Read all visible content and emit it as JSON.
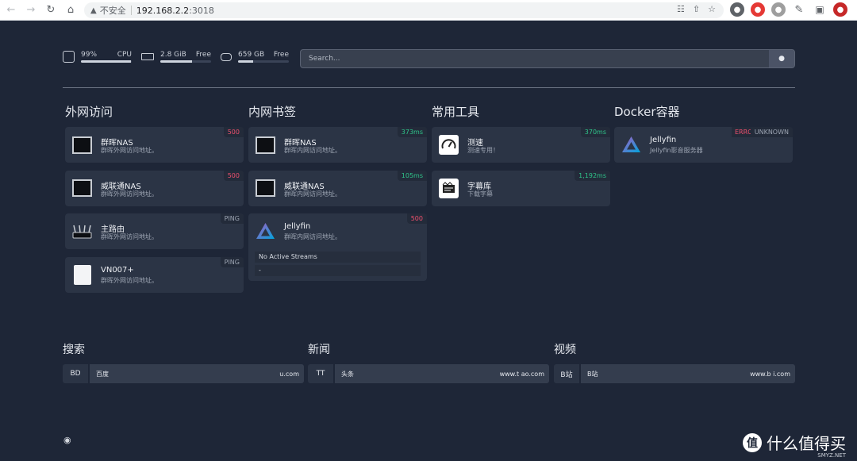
{
  "browser": {
    "insecure_label": "不安全",
    "url_host": "192.168.2.2",
    "url_port": ":3018"
  },
  "stats": {
    "cpu": {
      "value": "99%",
      "label": "CPU",
      "level": 0.99
    },
    "ram": {
      "value": "2.8 GiB",
      "label": "Free",
      "level": 0.62
    },
    "disk": {
      "value": "659 GB",
      "label": "Free",
      "level": 0.3
    }
  },
  "search": {
    "placeholder": "Search..."
  },
  "columns": [
    {
      "title": "外网访问",
      "cards": [
        {
          "name": "群晖NAS",
          "desc": "群晖外网访问地址。",
          "badge": "500",
          "badge_type": "red",
          "icon": "nas-icon"
        },
        {
          "name": "威联通NAS",
          "desc": "群晖外网访问地址。",
          "badge": "500",
          "badge_type": "red",
          "icon": "nas-icon"
        },
        {
          "name": "主路由",
          "desc": "群晖外网访问地址。",
          "badge": "PING",
          "badge_type": "grey",
          "icon": "router-icon"
        },
        {
          "name": "VN007+",
          "desc": "群晖外网访问地址。",
          "badge": "PING",
          "badge_type": "grey",
          "icon": "cpe-icon"
        }
      ]
    },
    {
      "title": "内网书签",
      "cards": [
        {
          "name": "群晖NAS",
          "desc": "群晖内网访问地址。",
          "badge": "373ms",
          "badge_type": "green",
          "icon": "nas-icon"
        },
        {
          "name": "威联通NAS",
          "desc": "群晖内网访问地址。",
          "badge": "105ms",
          "badge_type": "green",
          "icon": "nas-icon"
        },
        {
          "name": "Jellyfin",
          "desc": "群晖内网访问地址。",
          "badge": "500",
          "badge_type": "red",
          "icon": "jellyfin-icon",
          "stream_status": "No Active Streams",
          "stream_detail": "-"
        }
      ]
    },
    {
      "title": "常用工具",
      "cards": [
        {
          "name": "测速",
          "desc": "测速专用！",
          "badge": "370ms",
          "badge_type": "green",
          "icon": "speedometer-icon"
        },
        {
          "name": "字幕库",
          "desc": "下载字幕",
          "badge": "1,192ms",
          "badge_type": "green",
          "icon": "subtitle-icon"
        }
      ]
    },
    {
      "title": "Docker容器",
      "cards": [
        {
          "name": "Jellyfin",
          "desc": "Jellyfin影音服务器",
          "badge": "UNKNOWN",
          "badge_type": "grey",
          "badge2": "ERROR",
          "icon": "jellyfin-icon"
        }
      ]
    }
  ],
  "bottom": [
    {
      "title": "搜索",
      "key": "BD",
      "name": "百度",
      "url": "u.com"
    },
    {
      "title": "新闻",
      "key": "TT",
      "name": "头条",
      "url": "www.t     ao.com"
    },
    {
      "title": "视频",
      "key": "B站",
      "name": "B站",
      "url": "www.b    i.com"
    }
  ],
  "watermark": {
    "icon_text": "值",
    "text": "什么值得买",
    "sub": "SMYZ.NET"
  }
}
